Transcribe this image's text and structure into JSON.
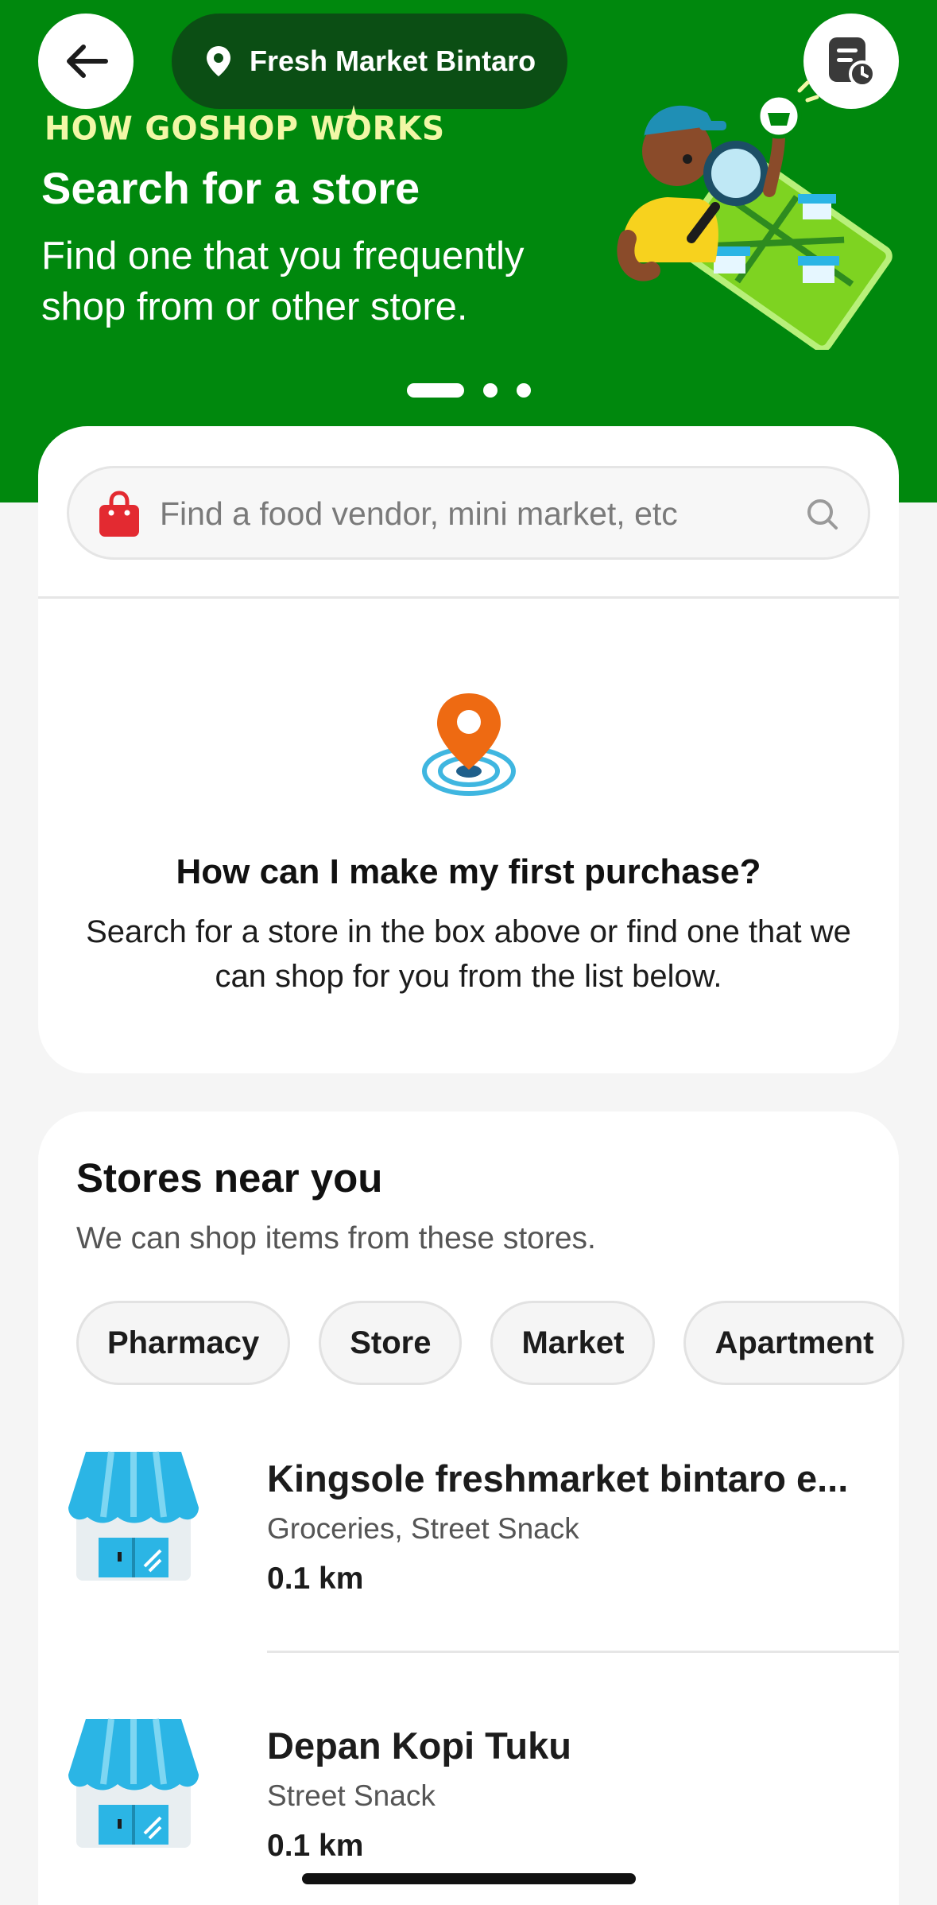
{
  "header": {
    "location": "Fresh Market Bintaro",
    "back_icon": "arrow-left-icon",
    "orders_icon": "order-history-icon"
  },
  "hero": {
    "tag": "HOW GOSHOP WORKS",
    "title": "Search for a store",
    "description": "Find one that you frequently shop from or other store.",
    "slides": 3,
    "active_slide": 1
  },
  "search": {
    "placeholder": "Find a food vendor, mini market, etc"
  },
  "empty_state": {
    "title": "How can I make my first purchase?",
    "description": "Search for a store in the box above or find one that we can shop for you from the list below."
  },
  "stores_section": {
    "title": "Stores near you",
    "subtitle": "We can shop items from these stores.",
    "chips": [
      "Pharmacy",
      "Store",
      "Market",
      "Apartment"
    ],
    "items": [
      {
        "name": "Kingsole freshmarket bintaro e...",
        "category": "Groceries, Street Snack",
        "distance": "0.1 km"
      },
      {
        "name": "Depan Kopi Tuku",
        "category": "Street Snack",
        "distance": "0.1 km"
      }
    ]
  },
  "colors": {
    "brand_green": "#00880d",
    "pill_dark": "#0b4e14",
    "tag_yellow": "#f2f7a6",
    "bag_red": "#e32a31",
    "pin_orange": "#ee6a12",
    "store_blue": "#2bb5e5"
  }
}
